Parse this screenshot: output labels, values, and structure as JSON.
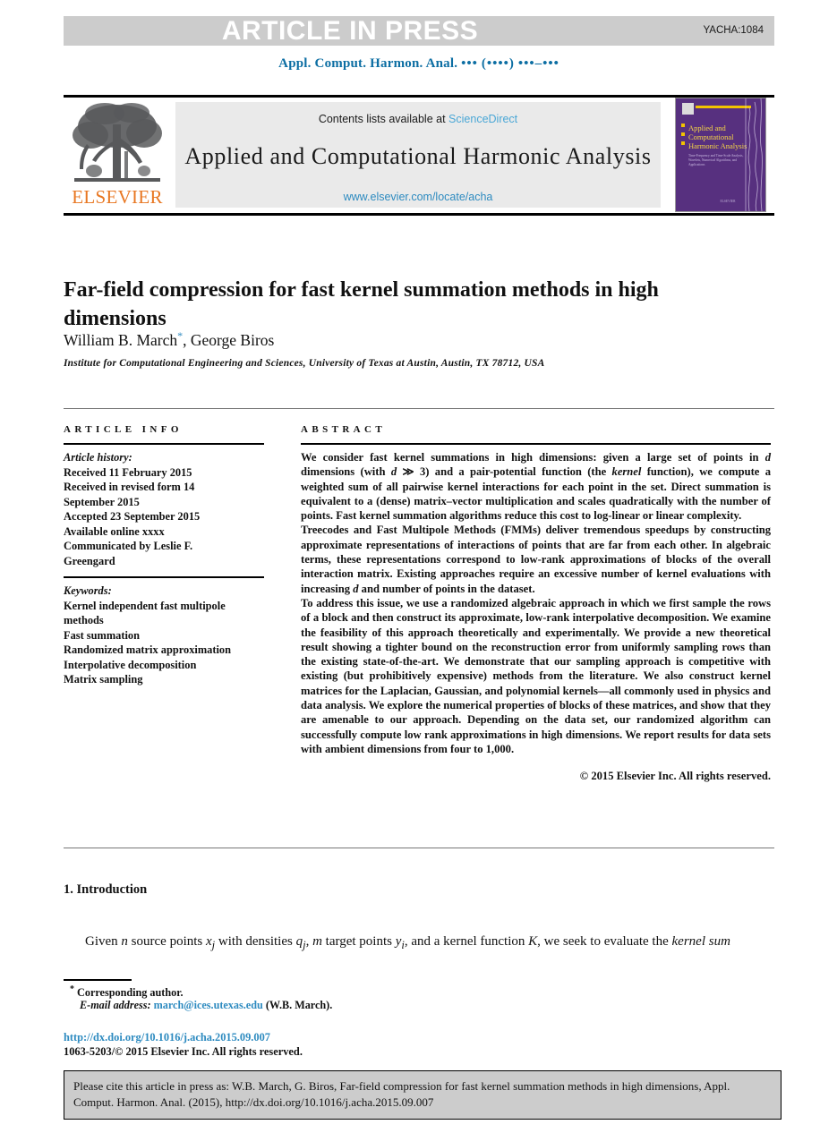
{
  "banner": {
    "text": "ARTICLE IN PRESS",
    "code": "YACHA:1084"
  },
  "running_head": {
    "journal_abbrev": "Appl. Comput. Harmon. Anal.",
    "volume_dots": "•••",
    "year_dots": "(••••)",
    "pages_dots": "•••–•••",
    "color": "#0c6ea3"
  },
  "masthead": {
    "publisher_logo_label": "ELSEVIER",
    "contents_prefix": "Contents lists available at",
    "contents_link": "ScienceDirect",
    "journal_name": "Applied and Computational Harmonic Analysis",
    "journal_url": "www.elsevier.com/locate/acha",
    "cover": {
      "title_line1": "Applied and",
      "title_line2": "Computational",
      "title_line3": "Harmonic Analysis",
      "subtitle": "Time-Frequency and Time-Scale Analysis, Wavelets, Numerical Algorithms, and Applications",
      "footer": "ELSEVIER",
      "background_color": "#57307f",
      "accent_color": "#f2c300"
    }
  },
  "article": {
    "title": "Far-field compression for fast kernel summation methods in high dimensions",
    "authors": "William B. March",
    "author_star": "*",
    "authors_rest": ", George Biros",
    "affiliation": "Institute for Computational Engineering and Sciences, University of Texas at Austin, Austin, TX 78712, USA"
  },
  "article_info": {
    "heading": "ARTICLE INFO",
    "history_label": "Article history:",
    "history_lines": [
      "Received 11 February 2015",
      "Received in revised form 14",
      "September 2015",
      "Accepted 23 September 2015",
      "Available online xxxx",
      "Communicated by Leslie F.",
      "Greengard"
    ],
    "keywords_label": "Keywords:",
    "keywords": [
      "Kernel independent fast multipole",
      "methods",
      "Fast summation",
      "Randomized matrix approximation",
      "Interpolative decomposition",
      "Matrix sampling"
    ]
  },
  "abstract": {
    "heading": "ABSTRACT",
    "paragraph1_a": "We consider fast kernel summations in high dimensions: given a large set of points in ",
    "paragraph1_d1": "d",
    "paragraph1_b": " dimensions (with ",
    "paragraph1_d2": "d",
    "paragraph1_c": " ≫ 3) and a pair-potential function (the ",
    "paragraph1_kernel": "kernel",
    "paragraph1_d": " function), we compute a weighted sum of all pairwise kernel interactions for each point in the set. Direct summation is equivalent to a (dense) matrix–vector multiplication and scales quadratically with the number of points. Fast kernel summation algorithms reduce this cost to log-linear or linear complexity.",
    "paragraph2_a": "Treecodes and Fast Multipole Methods (FMMs) deliver tremendous speedups by constructing approximate representations of interactions of points that are far from each other. In algebraic terms, these representations correspond to low-rank approximations of blocks of the overall interaction matrix. Existing approaches require an excessive number of kernel evaluations with increasing ",
    "paragraph2_d": "d",
    "paragraph2_b": " and number of points in the dataset.",
    "paragraph3": "To address this issue, we use a randomized algebraic approach in which we first sample the rows of a block and then construct its approximate, low-rank interpolative decomposition. We examine the feasibility of this approach theoretically and experimentally. We provide a new theoretical result showing a tighter bound on the reconstruction error from uniformly sampling rows than the existing state-of-the-art. We demonstrate that our sampling approach is competitive with existing (but prohibitively expensive) methods from the literature. We also construct kernel matrices for the Laplacian, Gaussian, and polynomial kernels—all commonly used in physics and data analysis. We explore the numerical properties of blocks of these matrices, and show that they are amenable to our approach. Depending on the data set, our randomized algorithm can successfully compute low rank approximations in high dimensions. We report results for data sets with ambient dimensions from four to 1,000.",
    "copyright": "© 2015 Elsevier Inc. All rights reserved."
  },
  "introduction": {
    "heading": "1. Introduction",
    "body_a": "Given ",
    "body_n": "n",
    "body_b": " source points ",
    "body_xj": "x",
    "body_xj_sub": "j",
    "body_c": " with densities ",
    "body_qj": "q",
    "body_qj_sub": "j",
    "body_d": ", ",
    "body_m": "m",
    "body_e": " target points ",
    "body_yi": "y",
    "body_yi_sub": "i",
    "body_f": ", and a kernel function ",
    "body_K": "K",
    "body_g": ", we seek to evaluate the ",
    "body_kernelsum": "kernel sum"
  },
  "footnote": {
    "star": "*",
    "corresponding": "Corresponding author.",
    "email_label": "E-mail address:",
    "email": "march@ices.utexas.edu",
    "email_owner": "(W.B. March).",
    "doi": "http://dx.doi.org/10.1016/j.acha.2015.09.007",
    "issn": "1063-5203/© 2015 Elsevier Inc. All rights reserved."
  },
  "cite_box": {
    "text": "Please cite this article in press as: W.B. March, G. Biros, Far-field compression for fast kernel summation methods in high dimensions, Appl. Comput. Harmon. Anal. (2015), http://dx.doi.org/10.1016/j.acha.2015.09.007",
    "background_color": "#cccccc"
  }
}
